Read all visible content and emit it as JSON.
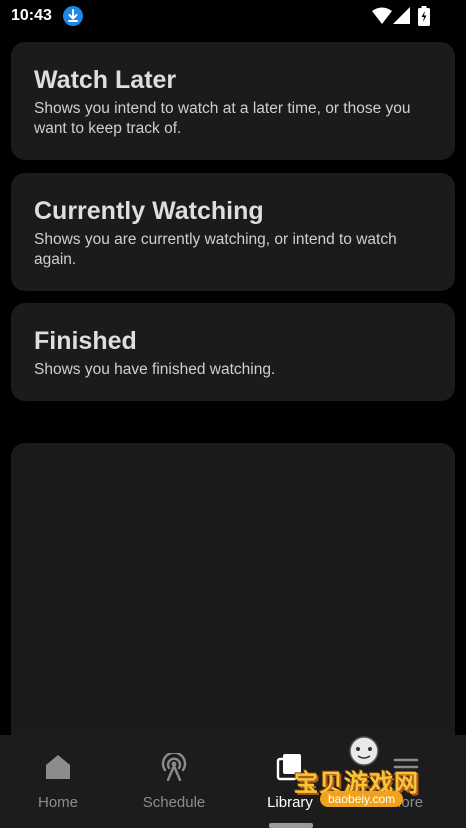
{
  "status_bar": {
    "time": "10:43"
  },
  "cards": [
    {
      "title": "Watch Later",
      "description": "Shows you intend to watch at a later time, or those you want to keep track of."
    },
    {
      "title": "Currently Watching",
      "description": "Shows you are currently watching, or intend to watch again."
    },
    {
      "title": "Finished",
      "description": "Shows you have finished watching."
    }
  ],
  "nav": {
    "items": [
      {
        "label": "Home",
        "icon": "home-icon"
      },
      {
        "label": "Schedule",
        "icon": "broadcast-icon"
      },
      {
        "label": "Library",
        "icon": "library-icon"
      },
      {
        "label": "More",
        "icon": "menu-icon"
      }
    ],
    "active": "Library"
  },
  "watermark": {
    "text": "宝贝游戏网",
    "url": "baobeiy.com"
  },
  "colors": {
    "background": "#000000",
    "card": "#1b1b1b",
    "nav": "#1c1c1c",
    "accent_download": "#1e88e5"
  }
}
